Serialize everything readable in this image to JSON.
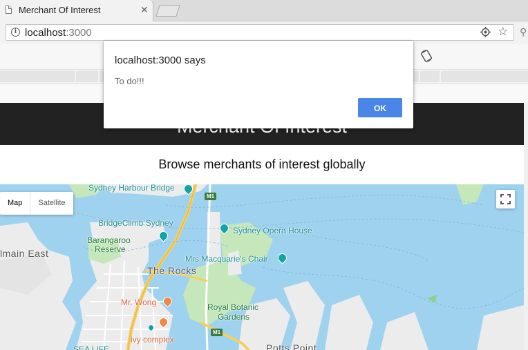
{
  "browser": {
    "tab_title": "Merchant Of Interest",
    "tab_close": "✕",
    "url_host": "localhost",
    "url_port": ":3000"
  },
  "page": {
    "header_title": "Merchant Of Interest",
    "subtitle": "Browse merchants of interest globally"
  },
  "map": {
    "type_control": {
      "map_label": "Map",
      "satellite_label": "Satellite"
    },
    "labels": {
      "harbour_bridge": "Sydney Harbour Bridge",
      "bridgeclimb": "BridgeClimb Sydney",
      "barangaroo": "Barangaroo",
      "barangaroo_reserve": "Reserve",
      "opera_house": "Sydney Opera House",
      "balmain_east": "lmain East",
      "mrs_macquarie": "Mrs Macquarie's Chair",
      "the_rocks": "The Rocks",
      "mr_wong": "Mr. Wong",
      "royal_botanic": "Royal Botanic",
      "gardens": "Gardens",
      "ivy_complex": "ivy complex",
      "sea_life": "SEA LIFE",
      "potts_point": "Potts Point"
    },
    "shields": {
      "m1_top": "M1",
      "m1_bottom": "M1"
    },
    "colors": {
      "water": "#9fd2ee",
      "land": "#ececec",
      "park": "#c6e7b9",
      "road": "#f6cf61",
      "teal": "#12a3a8"
    }
  },
  "dialog": {
    "title": "localhost:3000 says",
    "message": "To do!!!",
    "ok_label": "OK"
  }
}
